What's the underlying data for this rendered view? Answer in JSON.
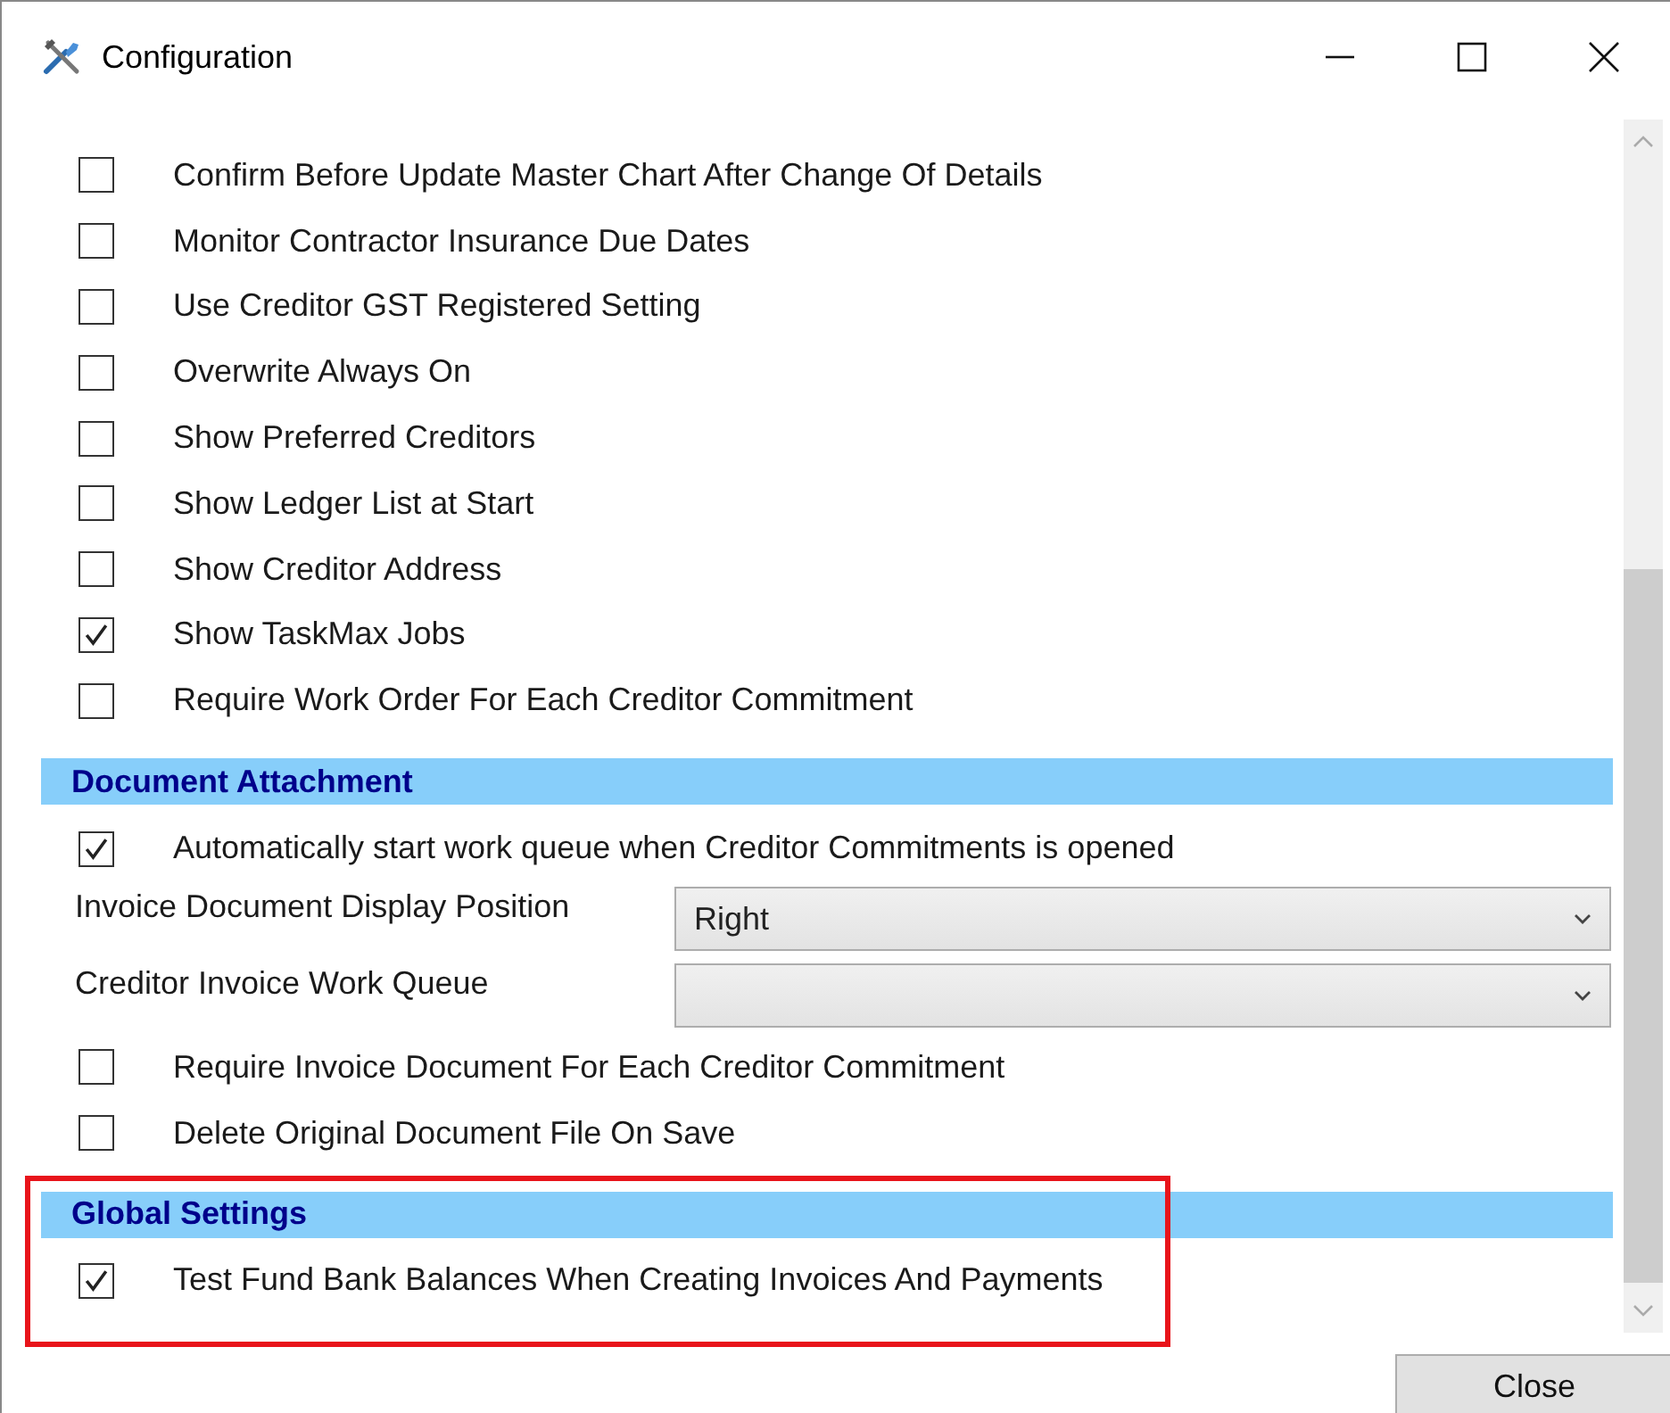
{
  "window": {
    "title": "Configuration"
  },
  "items": [
    {
      "kind": "checkbox",
      "label": "Confirm Before Update Master Chart After Change Of Details",
      "checked": false
    },
    {
      "kind": "checkbox",
      "label": "Monitor Contractor Insurance Due Dates",
      "checked": false
    },
    {
      "kind": "checkbox",
      "label": "Use Creditor GST Registered Setting",
      "checked": false
    },
    {
      "kind": "checkbox",
      "label": "Overwrite Always On",
      "checked": false
    },
    {
      "kind": "checkbox",
      "label": "Show Preferred Creditors",
      "checked": false
    },
    {
      "kind": "checkbox",
      "label": "Show Ledger List at Start",
      "checked": false
    },
    {
      "kind": "checkbox",
      "label": "Show Creditor Address",
      "checked": false
    },
    {
      "kind": "checkbox",
      "label": "Show TaskMax Jobs",
      "checked": true
    },
    {
      "kind": "checkbox",
      "label": "Require Work Order For Each Creditor Commitment",
      "checked": false
    },
    {
      "kind": "header",
      "label": "Document Attachment"
    },
    {
      "kind": "checkbox",
      "label": "Automatically start work queue when Creditor Commitments is opened",
      "checked": true
    },
    {
      "kind": "dropdown",
      "label": "Invoice Document Display Position",
      "value": "Right"
    },
    {
      "kind": "dropdown",
      "label": "Creditor Invoice Work Queue"
    },
    {
      "kind": "checkbox",
      "label": "Require Invoice Document For Each Creditor Commitment",
      "checked": false
    },
    {
      "kind": "checkbox",
      "label": "Delete Original Document File On Save",
      "checked": false
    },
    {
      "kind": "header",
      "label": "Global Settings"
    },
    {
      "kind": "checkbox",
      "label": "Test Fund Bank Balances When Creating Invoices And Payments",
      "checked": true
    }
  ],
  "close_button": "Close"
}
